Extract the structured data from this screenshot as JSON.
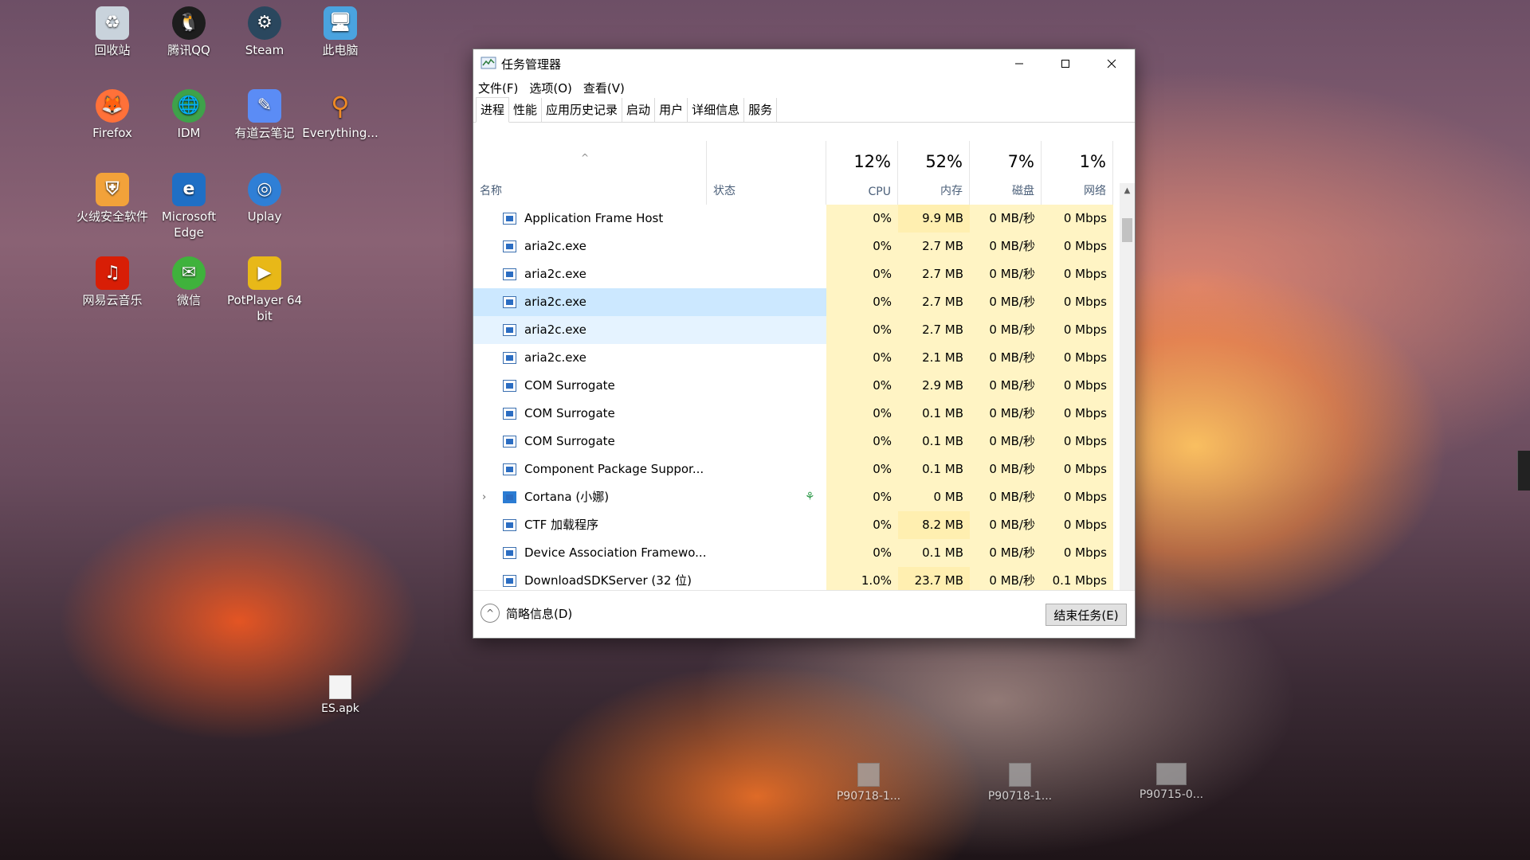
{
  "desktop": {
    "icons": [
      {
        "label": "回收站",
        "icon": "recycle-bin-icon",
        "color": "#c9d3dc"
      },
      {
        "label": "腾讯QQ",
        "icon": "qq-penguin-icon",
        "color": "#1d1d1d"
      },
      {
        "label": "Steam",
        "icon": "steam-icon",
        "color": "#2a475e"
      },
      {
        "label": "此电脑",
        "icon": "computer-icon",
        "color": "#4aa3df"
      },
      {
        "label": "Firefox",
        "icon": "firefox-icon",
        "color": "#ff7139"
      },
      {
        "label": "IDM",
        "icon": "idm-globe-icon",
        "color": "#3ea24a"
      },
      {
        "label": "有道云笔记",
        "icon": "youdao-note-icon",
        "color": "#5b8cf5"
      },
      {
        "label": "Everything...",
        "icon": "magnifier-icon",
        "color": "#f08a24"
      },
      {
        "label": "火绒安全软件",
        "icon": "huorong-shield-icon",
        "color": "#f2a23a"
      },
      {
        "label": "Microsoft Edge",
        "icon": "edge-icon",
        "color": "#1f6fc5"
      },
      {
        "label": "Uplay",
        "icon": "uplay-icon",
        "color": "#2f7fd6"
      },
      {
        "label": "网易云音乐",
        "icon": "netease-music-icon",
        "color": "#d81e06"
      },
      {
        "label": "微信",
        "icon": "wechat-icon",
        "color": "#3fb23c"
      },
      {
        "label": "PotPlayer 64 bit",
        "icon": "potplayer-icon",
        "color": "#e8b818"
      }
    ],
    "files": [
      {
        "label": "ES.apk",
        "icon": "file-icon"
      },
      {
        "label": "P90718-1...",
        "icon": "image-file-icon"
      },
      {
        "label": "P90718-1...",
        "icon": "image-file-icon"
      },
      {
        "label": "P90715-0...",
        "icon": "image-file-icon"
      }
    ]
  },
  "window": {
    "title": "任务管理器",
    "menu": [
      "文件(F)",
      "选项(O)",
      "查看(V)"
    ],
    "tabs": [
      "进程",
      "性能",
      "应用历史记录",
      "启动",
      "用户",
      "详细信息",
      "服务"
    ],
    "active_tab": "进程",
    "columns": {
      "name": "名称",
      "status": "状态",
      "cpu": {
        "pct": "12%",
        "label": "CPU"
      },
      "mem": {
        "pct": "52%",
        "label": "内存"
      },
      "disk": {
        "pct": "7%",
        "label": "磁盘"
      },
      "net": {
        "pct": "1%",
        "label": "网络"
      }
    },
    "rows": [
      {
        "name": "Application Frame Host",
        "cpu": "0%",
        "mem": "9.9 MB",
        "disk": "0 MB/秒",
        "net": "0 Mbps"
      },
      {
        "name": "aria2c.exe",
        "cpu": "0%",
        "mem": "2.7 MB",
        "disk": "0 MB/秒",
        "net": "0 Mbps"
      },
      {
        "name": "aria2c.exe",
        "cpu": "0%",
        "mem": "2.7 MB",
        "disk": "0 MB/秒",
        "net": "0 Mbps"
      },
      {
        "name": "aria2c.exe",
        "cpu": "0%",
        "mem": "2.7 MB",
        "disk": "0 MB/秒",
        "net": "0 Mbps"
      },
      {
        "name": "aria2c.exe",
        "cpu": "0%",
        "mem": "2.7 MB",
        "disk": "0 MB/秒",
        "net": "0 Mbps"
      },
      {
        "name": "aria2c.exe",
        "cpu": "0%",
        "mem": "2.1 MB",
        "disk": "0 MB/秒",
        "net": "0 Mbps"
      },
      {
        "name": "COM Surrogate",
        "cpu": "0%",
        "mem": "2.9 MB",
        "disk": "0 MB/秒",
        "net": "0 Mbps"
      },
      {
        "name": "COM Surrogate",
        "cpu": "0%",
        "mem": "0.1 MB",
        "disk": "0 MB/秒",
        "net": "0 Mbps"
      },
      {
        "name": "COM Surrogate",
        "cpu": "0%",
        "mem": "0.1 MB",
        "disk": "0 MB/秒",
        "net": "0 Mbps"
      },
      {
        "name": "Component Package Suppor...",
        "cpu": "0%",
        "mem": "0.1 MB",
        "disk": "0 MB/秒",
        "net": "0 Mbps"
      },
      {
        "name": "Cortana (小娜)",
        "cpu": "0%",
        "mem": "0 MB",
        "disk": "0 MB/秒",
        "net": "0 Mbps"
      },
      {
        "name": "CTF 加载程序",
        "cpu": "0%",
        "mem": "8.2 MB",
        "disk": "0 MB/秒",
        "net": "0 Mbps"
      },
      {
        "name": "Device Association Framewo...",
        "cpu": "0%",
        "mem": "0.1 MB",
        "disk": "0 MB/秒",
        "net": "0 Mbps"
      },
      {
        "name": "DownloadSDKServer (32 位)",
        "cpu": "1.0%",
        "mem": "23.7 MB",
        "disk": "0 MB/秒",
        "net": "0.1 Mbps"
      }
    ],
    "footer": {
      "brief_label": "简略信息(D)",
      "end_task_label": "结束任务(E)"
    }
  }
}
